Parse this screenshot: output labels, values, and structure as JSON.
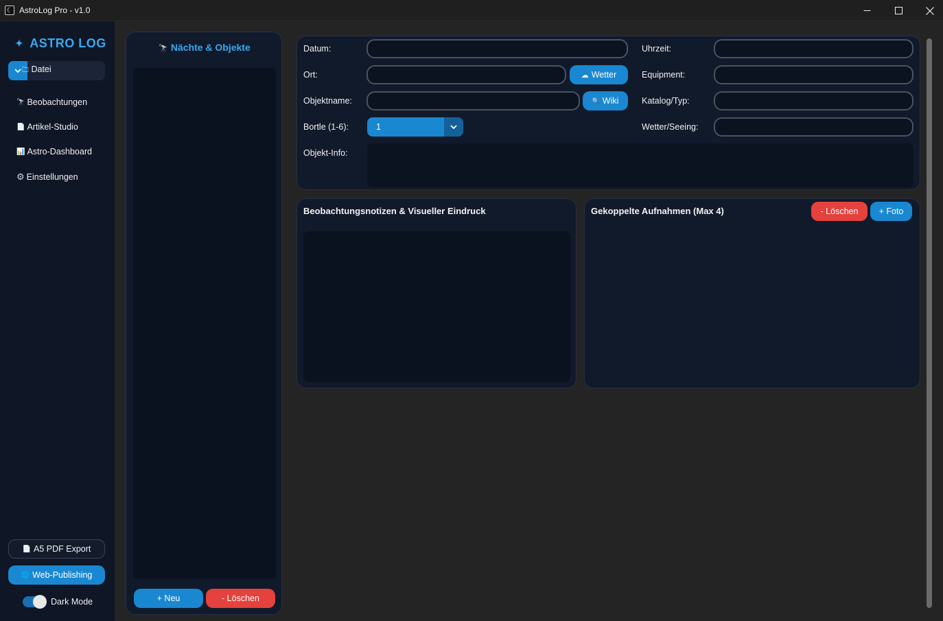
{
  "window": {
    "title": "AstroLog Pro - v1.0",
    "app_icon": "moon-icon"
  },
  "sidebar": {
    "logo": "ASTRO LOG",
    "logo_icon": "✦",
    "file_menu": {
      "icon": "🗀",
      "label": "Datei"
    },
    "nav": [
      {
        "icon": "🔭",
        "label": "Beobachtungen"
      },
      {
        "icon": "📄",
        "label": "Artikel-Studio"
      },
      {
        "icon": "📊",
        "label": "Astro-Dashboard"
      },
      {
        "icon": "⚙",
        "label": "Einstellungen"
      }
    ],
    "pdf_export": {
      "icon": "📄",
      "label": "A5 PDF Export"
    },
    "web_publishing": {
      "icon": "🌐",
      "label": "Web-Publishing"
    },
    "dark_mode": {
      "label": "Dark Mode",
      "on": true
    }
  },
  "list_panel": {
    "header_icon": "🔭",
    "header": "Nächte & Objekte",
    "new_button": "+ Neu",
    "delete_button": "- Löschen"
  },
  "form": {
    "datum_label": "Datum:",
    "uhrzeit_label": "Uhrzeit:",
    "ort_label": "Ort:",
    "wetter_button": {
      "icon": "☁",
      "label": "Wetter"
    },
    "equipment_label": "Equipment:",
    "objektname_label": "Objektname:",
    "wiki_button": {
      "icon": "🔍",
      "label": "Wiki"
    },
    "katalog_label": "Katalog/Typ:",
    "bortle_label": "Bortle (1-6):",
    "bortle_value": "1",
    "seeing_label": "Wetter/Seeing:",
    "objektinfo_label": "Objekt-Info:"
  },
  "notes_panel": {
    "title": "Beobachtungsnotizen & Visueller Eindruck"
  },
  "photo_panel": {
    "title": "Gekoppelte Aufnahmen (Max 4)",
    "delete_button": "- Löschen",
    "add_button": "+ Foto"
  },
  "colors": {
    "accent": "#1a87d1",
    "danger": "#e5413d",
    "panel": "#111a2b",
    "sidebar": "#0f1626"
  }
}
